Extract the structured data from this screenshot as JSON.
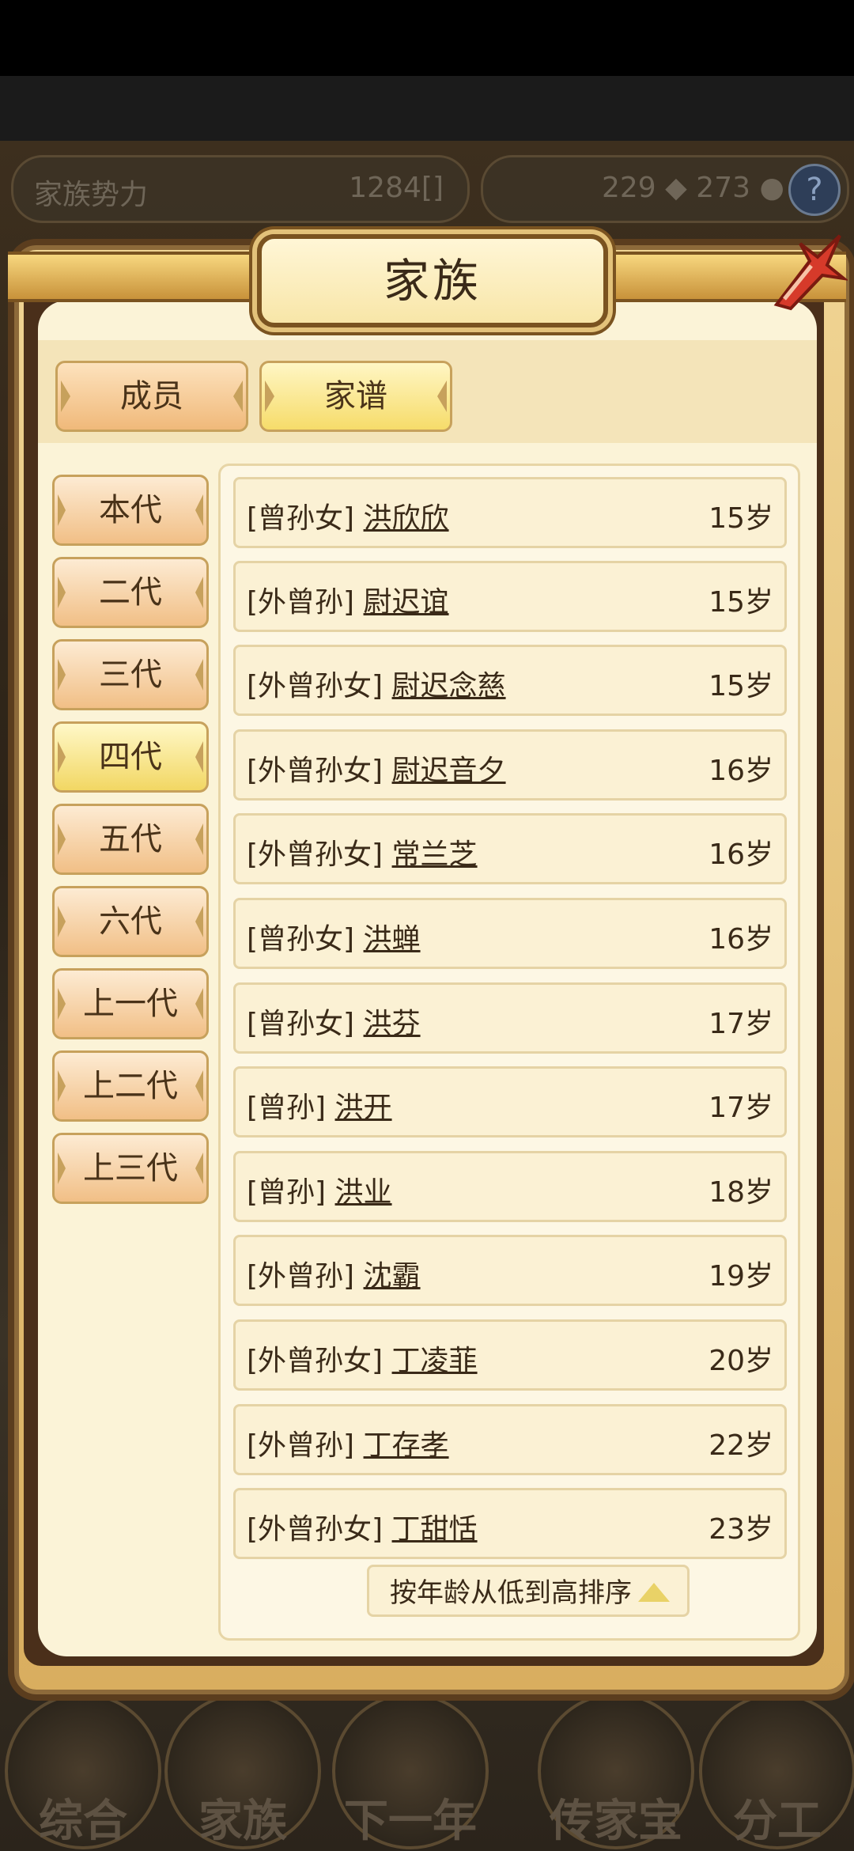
{
  "hud": {
    "left_label": "家族势力",
    "left_value": "1284[",
    "left_value_tail": "]",
    "right_counts": "229",
    "right_counts2": "273",
    "help": "?"
  },
  "modal": {
    "title": "家族",
    "tabs": [
      {
        "label": "成员"
      },
      {
        "label": "家谱"
      }
    ],
    "generations": [
      {
        "label": "本代"
      },
      {
        "label": "二代"
      },
      {
        "label": "三代"
      },
      {
        "label": "四代",
        "active": true
      },
      {
        "label": "五代"
      },
      {
        "label": "六代"
      },
      {
        "label": "上一代"
      },
      {
        "label": "上二代"
      },
      {
        "label": "上三代"
      }
    ],
    "members": [
      {
        "relation": "[曾孙女]",
        "name": "洪欣欣",
        "age": "15岁"
      },
      {
        "relation": "[外曾孙]",
        "name": "尉迟谊",
        "age": "15岁"
      },
      {
        "relation": "[外曾孙女]",
        "name": "尉迟念慈",
        "age": "15岁"
      },
      {
        "relation": "[外曾孙女]",
        "name": "尉迟音夕",
        "age": "16岁"
      },
      {
        "relation": "[外曾孙女]",
        "name": "常兰芝",
        "age": "16岁"
      },
      {
        "relation": "[曾孙女]",
        "name": "洪蝉",
        "age": "16岁"
      },
      {
        "relation": "[曾孙女]",
        "name": "洪芬",
        "age": "17岁"
      },
      {
        "relation": "[曾孙]",
        "name": "洪开",
        "age": "17岁"
      },
      {
        "relation": "[曾孙]",
        "name": "洪业",
        "age": "18岁"
      },
      {
        "relation": "[外曾孙]",
        "name": "沈霸",
        "age": "19岁"
      },
      {
        "relation": "[外曾孙女]",
        "name": "丁凌菲",
        "age": "20岁"
      },
      {
        "relation": "[外曾孙]",
        "name": "丁存孝",
        "age": "22岁"
      },
      {
        "relation": "[外曾孙女]",
        "name": "丁甜恬",
        "age": "23岁"
      }
    ],
    "sort_label": "按年龄从低到高排序"
  },
  "bottom_nav": [
    {
      "label": "综合"
    },
    {
      "label": "家族"
    },
    {
      "label": "下一年"
    },
    {
      "label": "传家宝"
    },
    {
      "label": "分工"
    }
  ],
  "colors": {
    "panel_bg": "#fbf3d7",
    "active_tab": "#f6dc6a",
    "inactive_tab": "#f0b97a",
    "frame": "#7a5320",
    "close_red": "#d63a2a"
  }
}
